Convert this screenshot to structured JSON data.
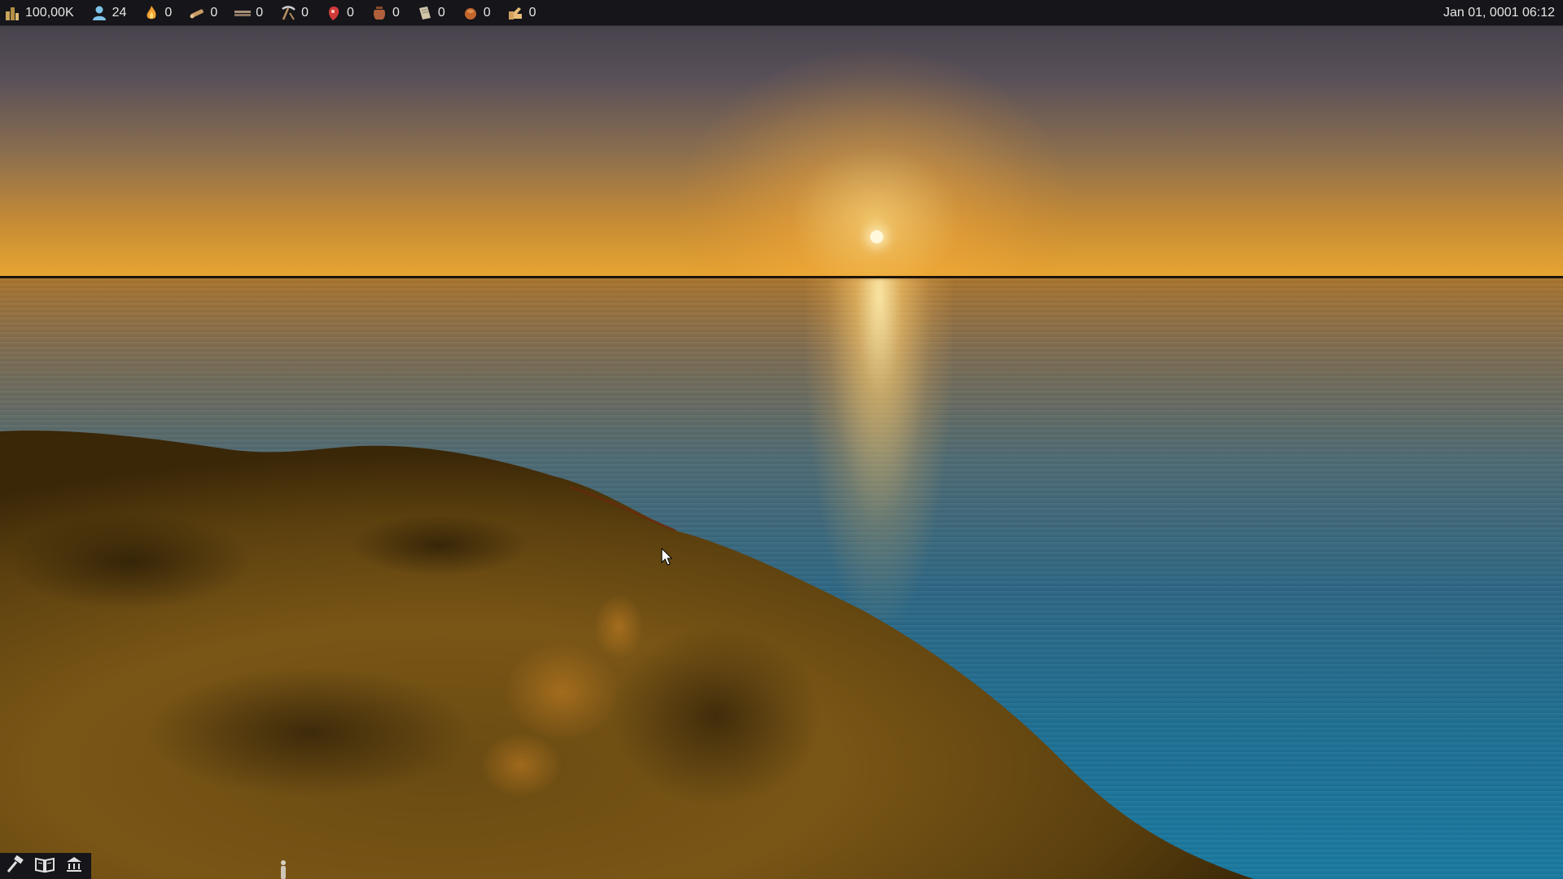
{
  "resources": [
    {
      "name": "money",
      "icon": "money-bag-icon",
      "value": "100,00K"
    },
    {
      "name": "population",
      "icon": "person-icon",
      "value": "24"
    },
    {
      "name": "fire",
      "icon": "fire-icon",
      "value": "0"
    },
    {
      "name": "wood",
      "icon": "wood-log-icon",
      "value": "0"
    },
    {
      "name": "plank",
      "icon": "plank-icon",
      "value": "0"
    },
    {
      "name": "tools",
      "icon": "pickaxe-icon",
      "value": "0"
    },
    {
      "name": "meat",
      "icon": "meat-icon",
      "value": "0"
    },
    {
      "name": "pottery",
      "icon": "pot-icon",
      "value": "0"
    },
    {
      "name": "paper",
      "icon": "scroll-icon",
      "value": "0"
    },
    {
      "name": "bread",
      "icon": "bread-icon",
      "value": "0"
    },
    {
      "name": "workers",
      "icon": "hand-icon",
      "value": "0"
    }
  ],
  "datetime": "Jan 01, 0001 06:12",
  "toolbar": {
    "tools": [
      {
        "name": "build",
        "icon": "hammer-icon"
      },
      {
        "name": "map",
        "icon": "open-book-icon"
      },
      {
        "name": "government",
        "icon": "capitol-icon"
      }
    ]
  },
  "colors": {
    "bar_bg": "#15151a",
    "text": "#e6e6e6",
    "sky_top": "#3e3b45",
    "sky_horizon": "#e7a531",
    "sea": "#1f6f93",
    "land": "#6e4f14"
  }
}
